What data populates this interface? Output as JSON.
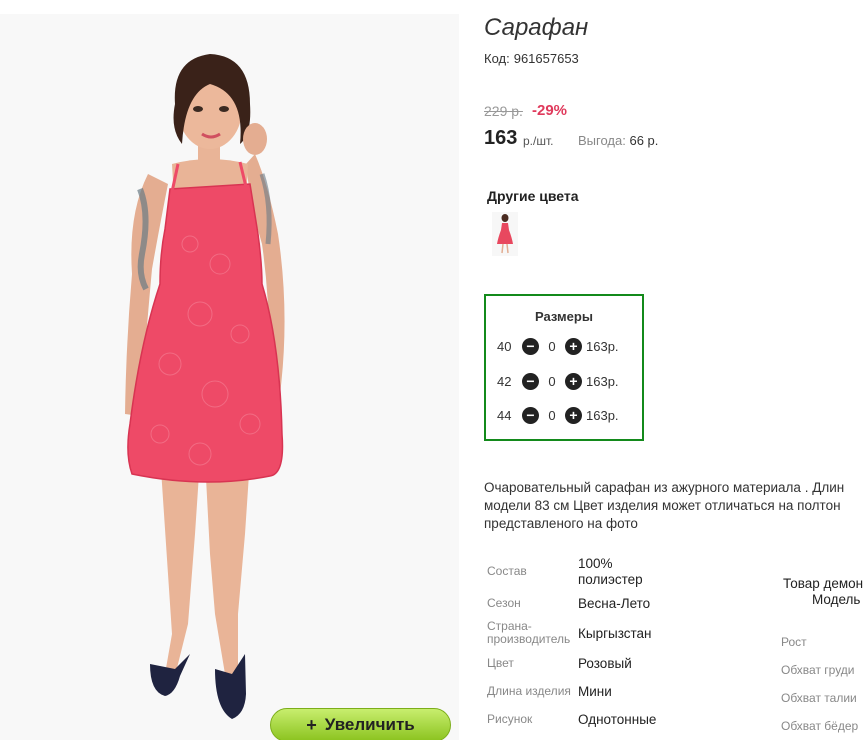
{
  "product": {
    "title": "Сарафан",
    "code_label": "Код:",
    "code": "961657653",
    "old_price": "229 р.",
    "discount": "-29%",
    "price": "163",
    "price_unit": "р./шт.",
    "benefit_label": "Выгода:",
    "benefit_value": "66 р."
  },
  "zoom": {
    "plus": "+",
    "label": "Увеличить"
  },
  "colors": {
    "title": "Другие цвета",
    "items": [
      {
        "name": "Розовый",
        "color": "#e8485f"
      }
    ]
  },
  "sizes": {
    "title": "Размеры",
    "rows": [
      {
        "size": "40",
        "qty": "0",
        "price": "163р."
      },
      {
        "size": "42",
        "qty": "0",
        "price": "163р."
      },
      {
        "size": "44",
        "qty": "0",
        "price": "163р."
      }
    ]
  },
  "description": {
    "line1": "Очаровательный сарафан из ажурного материала . Длин",
    "line2": "модели 83 см Цвет изделия может отличаться на полтон",
    "line3": "представленого на фото"
  },
  "attributes": [
    {
      "label": "Состав",
      "value_line1": "100%",
      "value_line2": "полиэстер"
    },
    {
      "label": "Сезон",
      "value": "Весна-Лето"
    },
    {
      "label_line1": "Страна-",
      "label_line2": "производитель",
      "value": "Кыргызстан"
    },
    {
      "label": "Цвет",
      "value": "Розовый"
    },
    {
      "label": "Длина изделия",
      "value": "Мини"
    },
    {
      "label": "Рисунок",
      "value": "Однотонные"
    }
  ],
  "model": {
    "title": "Товар демон",
    "subtitle": "Модель",
    "params": [
      "Рост",
      "Обхват груди",
      "Обхват талии",
      "Обхват бёдер"
    ]
  },
  "accent_colors": {
    "dress": "#ee4a67",
    "discount": "#e03a5c",
    "sizes_border": "#138a1b",
    "zoom_button": "#9ccf2f"
  }
}
